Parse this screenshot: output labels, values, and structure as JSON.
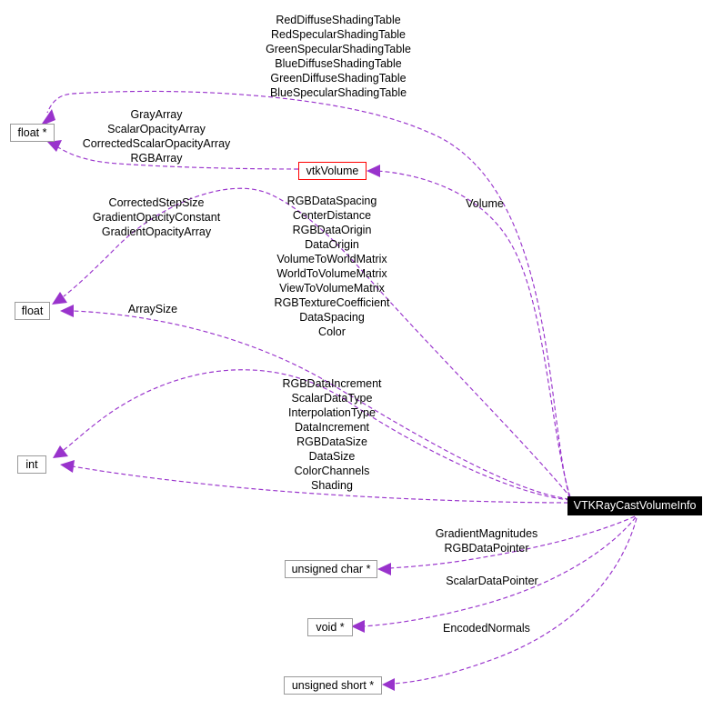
{
  "diagram": {
    "type": "collaboration-diagram",
    "title": "VTKRayCastVolumeInfo collaboration diagram",
    "colors": {
      "edge": "#9933cc",
      "focus_node_bg": "#000000",
      "focus_node_text": "#ffffff",
      "linked_node_border": "#ff0000",
      "plain_node_border": "#9a9a9a",
      "background": "#ffffff"
    },
    "nodes": [
      {
        "id": "floatptr",
        "label": "float *",
        "style": "plain"
      },
      {
        "id": "vtkvolume",
        "label": "vtkVolume",
        "style": "red"
      },
      {
        "id": "float",
        "label": "float",
        "style": "plain"
      },
      {
        "id": "int",
        "label": "int",
        "style": "plain"
      },
      {
        "id": "focus",
        "label": "VTKRayCastVolumeInfo",
        "style": "focus"
      },
      {
        "id": "ucharptr",
        "label": "unsigned char *",
        "style": "plain"
      },
      {
        "id": "voidptr",
        "label": "void *",
        "style": "plain"
      },
      {
        "id": "ushortptr",
        "label": "unsigned short *",
        "style": "plain"
      }
    ],
    "edge_labels": {
      "shading_tables": "RedDiffuseShadingTable\nRedSpecularShadingTable\nGreenSpecularShadingTable\nBlueDiffuseShadingTable\nGreenDiffuseShadingTable\nBlueSpecularShadingTable",
      "arrays": "GrayArray\nScalarOpacityArray\nCorrectedScalarOpacityArray\nRGBArray",
      "gradient": "CorrectedStepSize\nGradientOpacityConstant\nGradientOpacityArray",
      "volume": "Volume",
      "float_fields": "RGBDataSpacing\nCenterDistance\nRGBDataOrigin\nDataOrigin\nVolumeToWorldMatrix\nWorldToVolumeMatrix\nViewToVolumeMatrix\nRGBTextureCoefficient\nDataSpacing\nColor",
      "array_size": "ArraySize",
      "int_fields": "RGBDataIncrement\nScalarDataType\nInterpolationType\nDataIncrement\nRGBDataSize\nDataSize\nColorChannels\nShading",
      "uchar_fields": "GradientMagnitudes\nRGBDataPointer",
      "void_fields": "ScalarDataPointer",
      "ushort_fields": "EncodedNormals"
    },
    "label_lines": {
      "shading_tables": [
        "RedDiffuseShadingTable",
        "RedSpecularShadingTable",
        "GreenSpecularShadingTable",
        "BlueDiffuseShadingTable",
        "GreenDiffuseShadingTable",
        "BlueSpecularShadingTable"
      ],
      "arrays": [
        "GrayArray",
        "ScalarOpacityArray",
        "CorrectedScalarOpacityArray",
        "RGBArray"
      ],
      "gradient": [
        "CorrectedStepSize",
        "GradientOpacityConstant",
        "GradientOpacityArray"
      ],
      "volume": [
        "Volume"
      ],
      "float_fields": [
        "RGBDataSpacing",
        "CenterDistance",
        "RGBDataOrigin",
        "DataOrigin",
        "VolumeToWorldMatrix",
        "WorldToVolumeMatrix",
        "ViewToVolumeMatrix",
        "RGBTextureCoefficient",
        "DataSpacing",
        "Color"
      ],
      "array_size": [
        "ArraySize"
      ],
      "int_fields": [
        "RGBDataIncrement",
        "ScalarDataType",
        "InterpolationType",
        "DataIncrement",
        "RGBDataSize",
        "DataSize",
        "ColorChannels",
        "Shading"
      ],
      "uchar_fields": [
        "GradientMagnitudes",
        "RGBDataPointer"
      ],
      "void_fields": [
        "ScalarDataPointer"
      ],
      "ushort_fields": [
        "EncodedNormals"
      ]
    }
  }
}
